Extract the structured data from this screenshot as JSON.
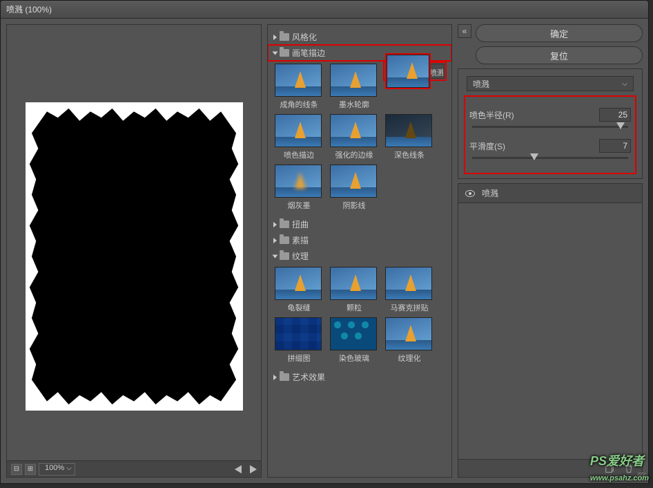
{
  "title": "喷溅 (100%)",
  "zoom": {
    "minus": "⊟",
    "plus": "⊞",
    "value": "100%"
  },
  "categories": {
    "stylize": "风格化",
    "brush_strokes": "画笔描边",
    "distort": "扭曲",
    "sketch": "素描",
    "texture": "纹理",
    "artistic": "艺术效果"
  },
  "brush_thumbs": [
    {
      "label": "成角的线条"
    },
    {
      "label": "墨水轮廓"
    },
    {
      "label": "喷溅"
    },
    {
      "label": "喷色描边"
    },
    {
      "label": "强化的边缘"
    },
    {
      "label": "深色线条"
    },
    {
      "label": "烟灰墨"
    },
    {
      "label": "阴影线"
    }
  ],
  "texture_thumbs": [
    {
      "label": "龟裂缝"
    },
    {
      "label": "颗粒"
    },
    {
      "label": "马赛克拼贴"
    },
    {
      "label": "拼缀图"
    },
    {
      "label": "染色玻璃"
    },
    {
      "label": "纹理化"
    }
  ],
  "buttons": {
    "ok": "确定",
    "reset": "复位"
  },
  "filter_select": "喷溅",
  "params": {
    "radius": {
      "label": "喷色半径(R)",
      "value": "25",
      "pos": 95
    },
    "smooth": {
      "label": "平滑度(S)",
      "value": "7",
      "pos": 40
    }
  },
  "layers": {
    "item": "喷溅"
  },
  "watermark": "PS爱好者",
  "watermark_url": "www.psahz.com"
}
